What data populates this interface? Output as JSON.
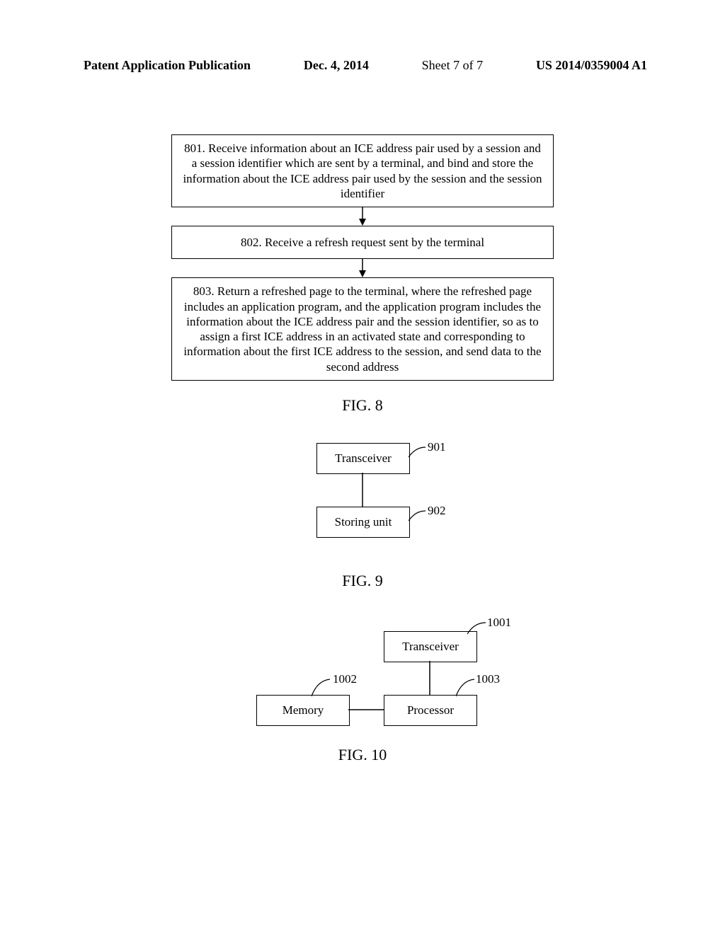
{
  "header": {
    "title": "Patent Application Publication",
    "date": "Dec. 4, 2014",
    "sheet": "Sheet 7 of 7",
    "pubno": "US 2014/0359004 A1"
  },
  "fig8": {
    "box801": "801. Receive information about an ICE address pair used by a session and a session identifier which are sent by a terminal, and bind and store the information about the ICE address pair used by the session and the session identifier",
    "box802": "802. Receive a refresh request sent by the terminal",
    "box803": "803. Return a refreshed page to the terminal, where the refreshed page includes an application program, and the application program includes the information about the ICE address pair and the session identifier, so as to assign a first ICE address in an activated state and corresponding to information about the first ICE address to the session, and send data to the second address",
    "label": "FIG. 8"
  },
  "fig9": {
    "box901": "Transceiver",
    "ref901": "901",
    "box902": "Storing unit",
    "ref902": "902",
    "label": "FIG. 9"
  },
  "fig10": {
    "box1001": "Transceiver",
    "ref1001": "1001",
    "box1002": "Memory",
    "ref1002": "1002",
    "box1003": "Processor",
    "ref1003": "1003",
    "label": "FIG. 10"
  }
}
